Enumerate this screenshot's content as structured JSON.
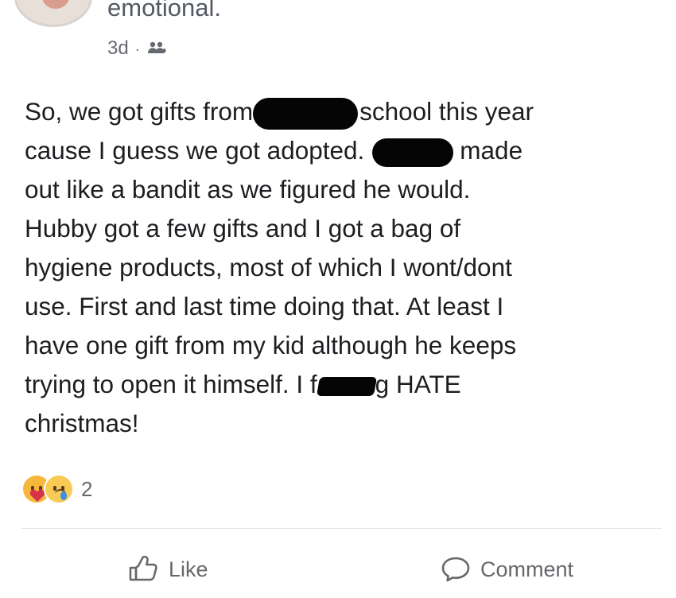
{
  "post": {
    "author_line": "emotional.",
    "timestamp": "3d",
    "separator": "·",
    "audience_icon": "friends-icon",
    "text": {
      "lines": [
        [
          "So, we got gifts from",
          "school this year"
        ],
        [
          "cause I guess we got adopted.",
          "made"
        ],
        [
          "out like a bandit as we figured he would."
        ],
        [
          "Hubby got a few gifts and I got a bag of"
        ],
        [
          "hygiene products, most of which I wont/dont"
        ],
        [
          "use. First and last time doing that. At least I"
        ],
        [
          "have one gift from my kid although he keeps"
        ],
        [
          "trying to open it himself. I f",
          "g HATE"
        ],
        [
          "christmas!"
        ]
      ]
    },
    "reactions": {
      "types": [
        "care-icon",
        "sad-icon"
      ],
      "count": "2"
    },
    "actions": {
      "like_label": "Like",
      "comment_label": "Comment"
    }
  }
}
